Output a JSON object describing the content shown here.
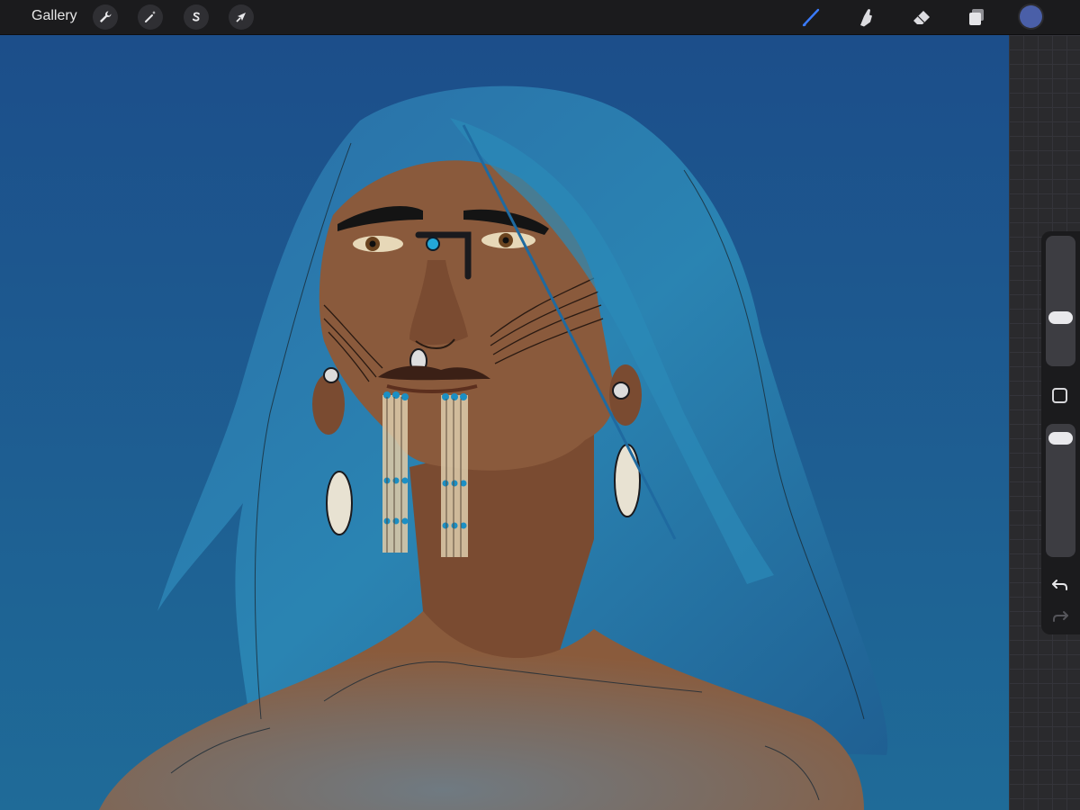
{
  "toolbar": {
    "gallery_label": "Gallery",
    "left_tools": [
      {
        "name": "actions",
        "icon": "wrench-icon"
      },
      {
        "name": "adjustments",
        "icon": "magic-wand-icon"
      },
      {
        "name": "selection",
        "icon": "selection-s-icon"
      },
      {
        "name": "transform",
        "icon": "arrow-cursor-icon"
      }
    ],
    "right_tools": [
      {
        "name": "brush",
        "icon": "paintbrush-icon",
        "active": true
      },
      {
        "name": "smudge",
        "icon": "smudge-finger-icon",
        "active": false
      },
      {
        "name": "eraser",
        "icon": "eraser-icon",
        "active": false
      },
      {
        "name": "layers",
        "icon": "layers-icon",
        "active": false
      }
    ],
    "current_color": "#4a5fa8"
  },
  "sidebar": {
    "brush_size_level": 0.35,
    "opacity_level": 0.95,
    "modify_icon": "square-icon",
    "undo_icon": "undo-arrow-icon",
    "redo_icon": "redo-arrow-icon"
  },
  "colors": {
    "accent_active": "#3a7bff",
    "canvas_bg_top": "#1c4f8c",
    "canvas_bg_bottom": "#1e6a9a",
    "hair": "#2a7fb0",
    "skin": "#8a5a3c"
  }
}
